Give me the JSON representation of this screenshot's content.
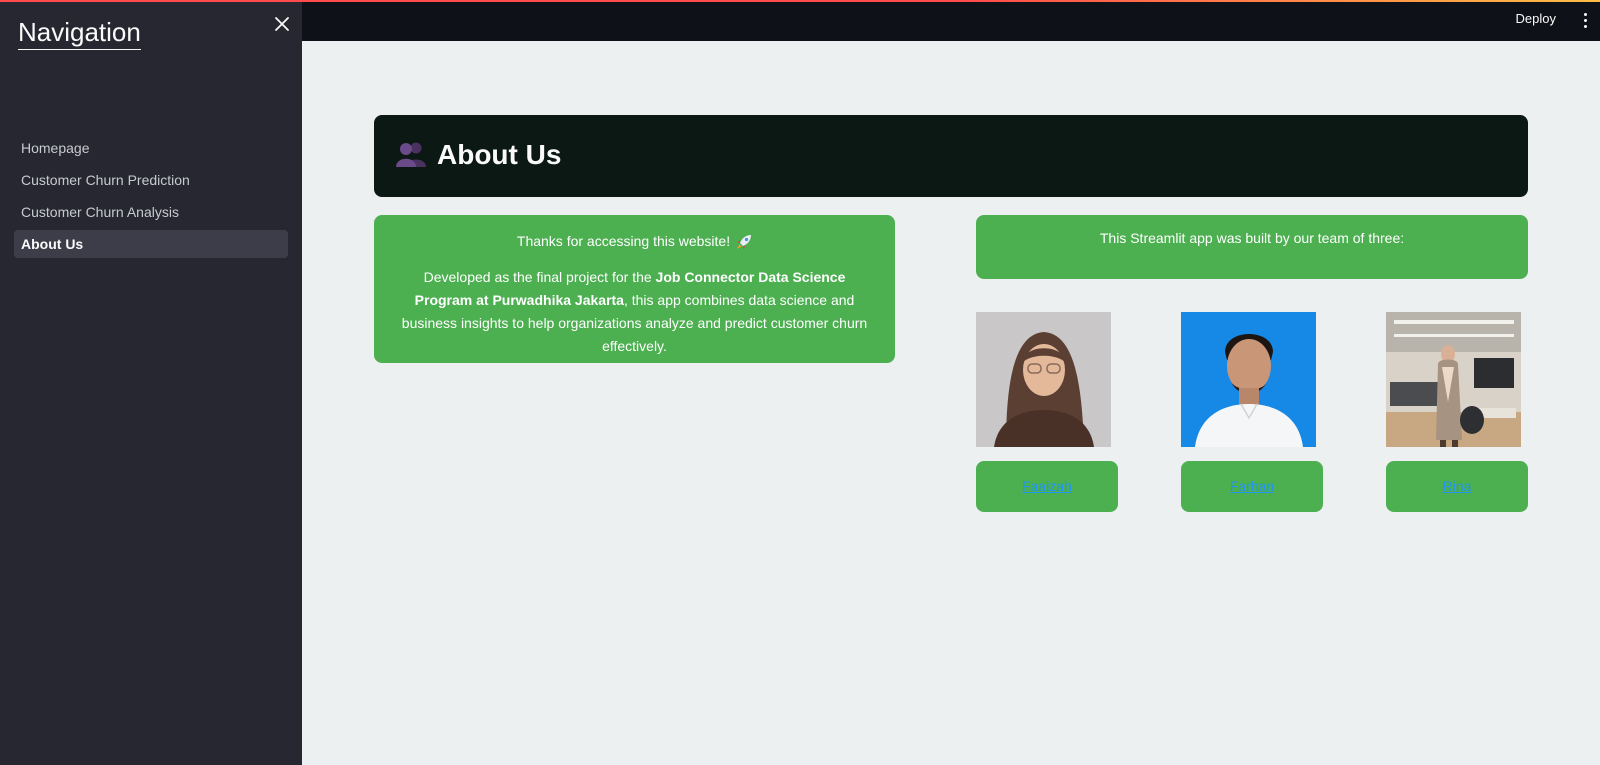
{
  "sidebar": {
    "title": "Navigation",
    "items": [
      {
        "label": "Homepage",
        "active": false
      },
      {
        "label": "Customer Churn Prediction",
        "active": false
      },
      {
        "label": "Customer Churn Analysis",
        "active": false
      },
      {
        "label": "About Us",
        "active": true
      }
    ]
  },
  "header": {
    "deploy_label": "Deploy"
  },
  "main": {
    "title": "About Us",
    "title_icon": "busts-in-silhouette-icon",
    "intro": {
      "thanks": "Thanks for accessing this website!",
      "thanks_icon": "rocket-icon",
      "developed_prefix": "Developed as the final project for the ",
      "program_bold": "Job Connector Data Science Program at Purwadhika Jakarta",
      "developed_suffix": ", this app combines data science and business insights to help organizations analyze and predict customer churn effectively."
    },
    "team_intro": "This Streamlit app was built by our team of three:",
    "team": [
      {
        "name": "Faaizah"
      },
      {
        "name": "Farhan"
      },
      {
        "name": "Rina"
      }
    ]
  },
  "colors": {
    "sidebar_bg": "#262730",
    "header_bg": "#0e1117",
    "page_bg": "#edf0f1",
    "title_banner_bg": "#0c1813",
    "card_green": "#4caf50",
    "link_blue": "#2196f3"
  }
}
